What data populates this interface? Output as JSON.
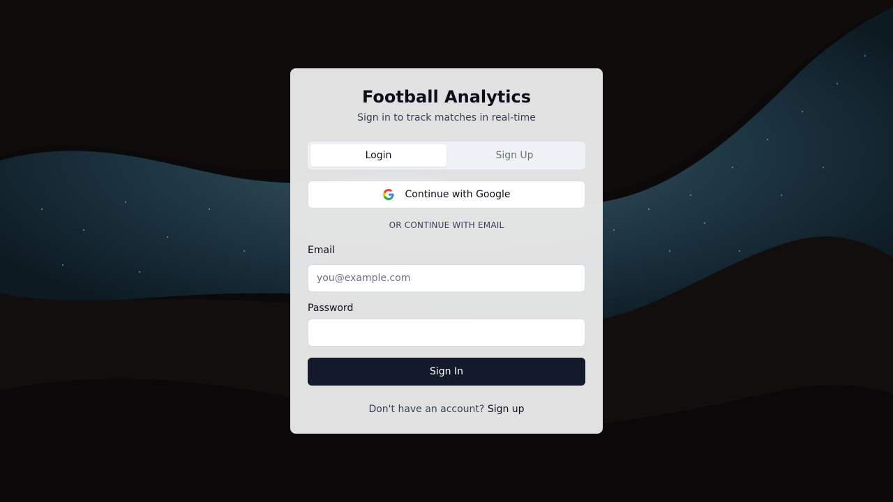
{
  "app": {
    "title": "Football Analytics",
    "subtitle": "Sign in to track matches in real-time"
  },
  "tabs": [
    {
      "label": "Login",
      "active": true
    },
    {
      "label": "Sign Up",
      "active": false
    }
  ],
  "oauth": {
    "google_label": "Continue with Google",
    "icon": "google-icon"
  },
  "divider": {
    "text": "OR CONTINUE WITH EMAIL"
  },
  "form": {
    "email_label": "Email",
    "email_placeholder": "you@example.com",
    "email_value": "",
    "password_label": "Password",
    "password_value": "",
    "submit_label": "Sign In"
  },
  "footer": {
    "prompt": "Don't have an account?",
    "link_label": "Sign up"
  },
  "colors": {
    "primary_button": "#121a2b",
    "card_background": "#e8e8e8",
    "page_background": "#0d0a0a"
  }
}
